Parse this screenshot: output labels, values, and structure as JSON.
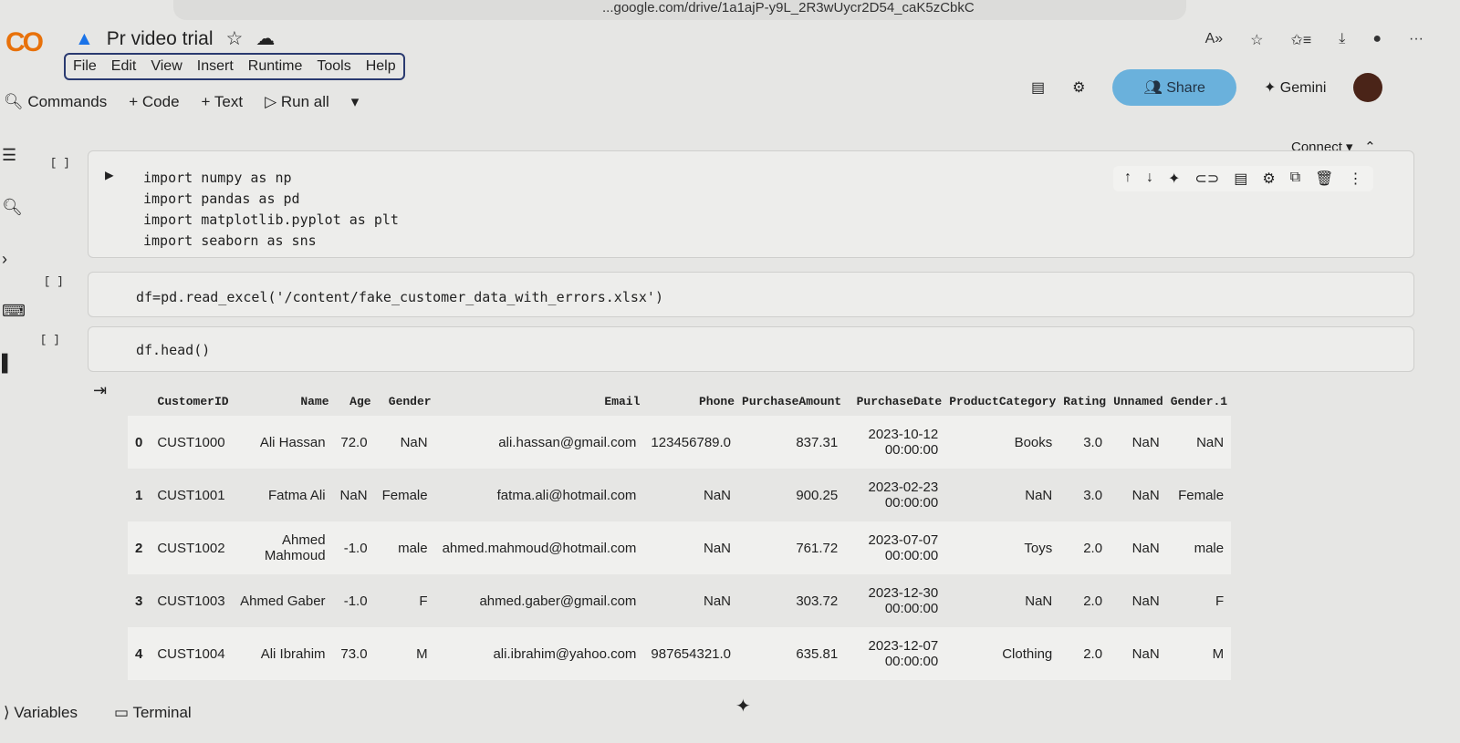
{
  "browser": {
    "url": "...google.com/drive/1a1ajP-y9L_2R3wUycr2D54_caK5zCbkC"
  },
  "header": {
    "title": "Pr video trial",
    "menu": [
      "File",
      "Edit",
      "View",
      "Insert",
      "Runtime",
      "Tools",
      "Help"
    ],
    "share": "Share",
    "gemini": "Gemini"
  },
  "toolbar": {
    "commands": "Commands",
    "code": "+ Code",
    "text": "+ Text",
    "run_all": "▷ Run all"
  },
  "connect": "Connect",
  "cells": [
    {
      "bracket": "[ ]",
      "code": "import numpy as np\nimport pandas as pd\nimport matplotlib.pyplot as plt\nimport seaborn as sns"
    },
    {
      "bracket": "[ ]",
      "code": "df=pd.read_excel('/content/fake_customer_data_with_errors.xlsx')"
    },
    {
      "bracket": "[ ]",
      "code": "df.head()"
    }
  ],
  "table": {
    "columns": [
      "",
      "CustomerID",
      "Name",
      "Age",
      "Gender",
      "Email",
      "Phone",
      "PurchaseAmount",
      "PurchaseDate",
      "ProductCategory",
      "Rating",
      "Unnamed",
      "Gender.1"
    ],
    "rows": [
      [
        "0",
        "CUST1000",
        "Ali Hassan",
        "72.0",
        "NaN",
        "ali.hassan@gmail.com",
        "123456789.0",
        "837.31",
        "2023-10-12 00:00:00",
        "Books",
        "3.0",
        "NaN",
        "NaN"
      ],
      [
        "1",
        "CUST1001",
        "Fatma Ali",
        "NaN",
        "Female",
        "fatma.ali@hotmail.com",
        "NaN",
        "900.25",
        "2023-02-23 00:00:00",
        "NaN",
        "3.0",
        "NaN",
        "Female"
      ],
      [
        "2",
        "CUST1002",
        "Ahmed Mahmoud",
        "-1.0",
        "male",
        "ahmed.mahmoud@hotmail.com",
        "NaN",
        "761.72",
        "2023-07-07 00:00:00",
        "Toys",
        "2.0",
        "NaN",
        "male"
      ],
      [
        "3",
        "CUST1003",
        "Ahmed Gaber",
        "-1.0",
        "F",
        "ahmed.gaber@gmail.com",
        "NaN",
        "303.72",
        "2023-12-30 00:00:00",
        "NaN",
        "2.0",
        "NaN",
        "F"
      ],
      [
        "4",
        "CUST1004",
        "Ali Ibrahim",
        "73.0",
        "M",
        "ali.ibrahim@yahoo.com",
        "987654321.0",
        "635.81",
        "2023-12-07 00:00:00",
        "Clothing",
        "2.0",
        "NaN",
        "M"
      ]
    ]
  },
  "status": {
    "variables": "Variables",
    "terminal": "Terminal"
  }
}
